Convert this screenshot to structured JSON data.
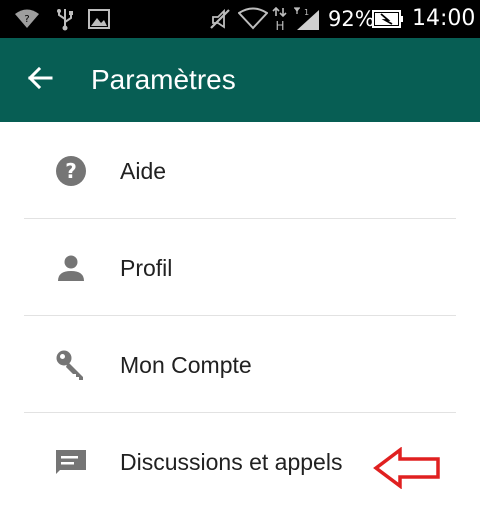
{
  "status_bar": {
    "battery_percent": "92%",
    "time": "14:00",
    "network_type": "H",
    "sim_label": "1",
    "icons": [
      "wifi-question-icon",
      "usb-icon",
      "image-icon",
      "mute-icon",
      "wifi-icon",
      "data-arrows-icon",
      "signal-icon",
      "battery-icon"
    ]
  },
  "app_bar": {
    "title": "Paramètres",
    "background": "#075e54",
    "back_icon": "arrow-back-icon"
  },
  "settings": {
    "items": [
      {
        "label": "Aide",
        "icon": "help-icon"
      },
      {
        "label": "Profil",
        "icon": "person-icon"
      },
      {
        "label": "Mon Compte",
        "icon": "key-icon"
      },
      {
        "label": "Discussions et appels",
        "icon": "chat-icon"
      }
    ]
  },
  "annotation": {
    "arrow_color": "#e02020",
    "arrow_icon": "red-arrow-icon"
  }
}
